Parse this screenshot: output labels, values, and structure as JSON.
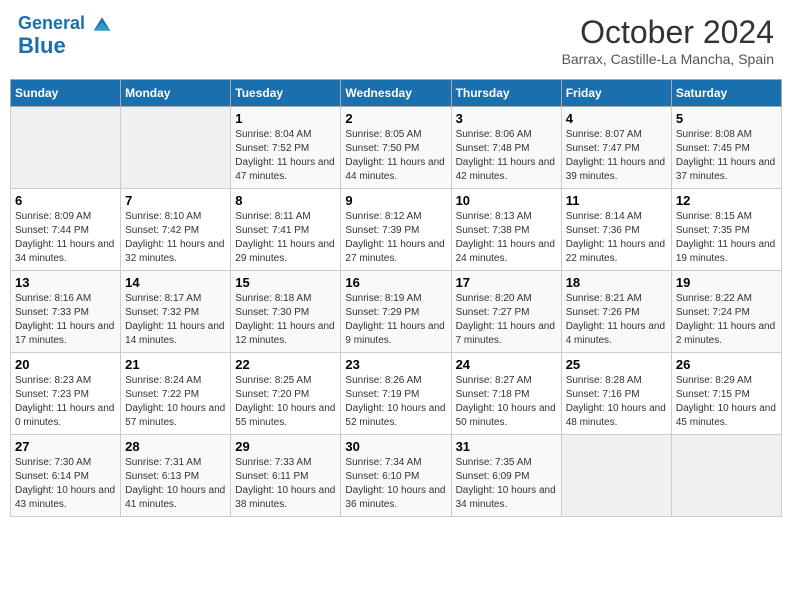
{
  "header": {
    "logo_line1": "General",
    "logo_line2": "Blue",
    "month": "October 2024",
    "location": "Barrax, Castille-La Mancha, Spain"
  },
  "weekdays": [
    "Sunday",
    "Monday",
    "Tuesday",
    "Wednesday",
    "Thursday",
    "Friday",
    "Saturday"
  ],
  "weeks": [
    [
      {
        "day": "",
        "info": ""
      },
      {
        "day": "",
        "info": ""
      },
      {
        "day": "1",
        "info": "Sunrise: 8:04 AM\nSunset: 7:52 PM\nDaylight: 11 hours and 47 minutes."
      },
      {
        "day": "2",
        "info": "Sunrise: 8:05 AM\nSunset: 7:50 PM\nDaylight: 11 hours and 44 minutes."
      },
      {
        "day": "3",
        "info": "Sunrise: 8:06 AM\nSunset: 7:48 PM\nDaylight: 11 hours and 42 minutes."
      },
      {
        "day": "4",
        "info": "Sunrise: 8:07 AM\nSunset: 7:47 PM\nDaylight: 11 hours and 39 minutes."
      },
      {
        "day": "5",
        "info": "Sunrise: 8:08 AM\nSunset: 7:45 PM\nDaylight: 11 hours and 37 minutes."
      }
    ],
    [
      {
        "day": "6",
        "info": "Sunrise: 8:09 AM\nSunset: 7:44 PM\nDaylight: 11 hours and 34 minutes."
      },
      {
        "day": "7",
        "info": "Sunrise: 8:10 AM\nSunset: 7:42 PM\nDaylight: 11 hours and 32 minutes."
      },
      {
        "day": "8",
        "info": "Sunrise: 8:11 AM\nSunset: 7:41 PM\nDaylight: 11 hours and 29 minutes."
      },
      {
        "day": "9",
        "info": "Sunrise: 8:12 AM\nSunset: 7:39 PM\nDaylight: 11 hours and 27 minutes."
      },
      {
        "day": "10",
        "info": "Sunrise: 8:13 AM\nSunset: 7:38 PM\nDaylight: 11 hours and 24 minutes."
      },
      {
        "day": "11",
        "info": "Sunrise: 8:14 AM\nSunset: 7:36 PM\nDaylight: 11 hours and 22 minutes."
      },
      {
        "day": "12",
        "info": "Sunrise: 8:15 AM\nSunset: 7:35 PM\nDaylight: 11 hours and 19 minutes."
      }
    ],
    [
      {
        "day": "13",
        "info": "Sunrise: 8:16 AM\nSunset: 7:33 PM\nDaylight: 11 hours and 17 minutes."
      },
      {
        "day": "14",
        "info": "Sunrise: 8:17 AM\nSunset: 7:32 PM\nDaylight: 11 hours and 14 minutes."
      },
      {
        "day": "15",
        "info": "Sunrise: 8:18 AM\nSunset: 7:30 PM\nDaylight: 11 hours and 12 minutes."
      },
      {
        "day": "16",
        "info": "Sunrise: 8:19 AM\nSunset: 7:29 PM\nDaylight: 11 hours and 9 minutes."
      },
      {
        "day": "17",
        "info": "Sunrise: 8:20 AM\nSunset: 7:27 PM\nDaylight: 11 hours and 7 minutes."
      },
      {
        "day": "18",
        "info": "Sunrise: 8:21 AM\nSunset: 7:26 PM\nDaylight: 11 hours and 4 minutes."
      },
      {
        "day": "19",
        "info": "Sunrise: 8:22 AM\nSunset: 7:24 PM\nDaylight: 11 hours and 2 minutes."
      }
    ],
    [
      {
        "day": "20",
        "info": "Sunrise: 8:23 AM\nSunset: 7:23 PM\nDaylight: 11 hours and 0 minutes."
      },
      {
        "day": "21",
        "info": "Sunrise: 8:24 AM\nSunset: 7:22 PM\nDaylight: 10 hours and 57 minutes."
      },
      {
        "day": "22",
        "info": "Sunrise: 8:25 AM\nSunset: 7:20 PM\nDaylight: 10 hours and 55 minutes."
      },
      {
        "day": "23",
        "info": "Sunrise: 8:26 AM\nSunset: 7:19 PM\nDaylight: 10 hours and 52 minutes."
      },
      {
        "day": "24",
        "info": "Sunrise: 8:27 AM\nSunset: 7:18 PM\nDaylight: 10 hours and 50 minutes."
      },
      {
        "day": "25",
        "info": "Sunrise: 8:28 AM\nSunset: 7:16 PM\nDaylight: 10 hours and 48 minutes."
      },
      {
        "day": "26",
        "info": "Sunrise: 8:29 AM\nSunset: 7:15 PM\nDaylight: 10 hours and 45 minutes."
      }
    ],
    [
      {
        "day": "27",
        "info": "Sunrise: 7:30 AM\nSunset: 6:14 PM\nDaylight: 10 hours and 43 minutes."
      },
      {
        "day": "28",
        "info": "Sunrise: 7:31 AM\nSunset: 6:13 PM\nDaylight: 10 hours and 41 minutes."
      },
      {
        "day": "29",
        "info": "Sunrise: 7:33 AM\nSunset: 6:11 PM\nDaylight: 10 hours and 38 minutes."
      },
      {
        "day": "30",
        "info": "Sunrise: 7:34 AM\nSunset: 6:10 PM\nDaylight: 10 hours and 36 minutes."
      },
      {
        "day": "31",
        "info": "Sunrise: 7:35 AM\nSunset: 6:09 PM\nDaylight: 10 hours and 34 minutes."
      },
      {
        "day": "",
        "info": ""
      },
      {
        "day": "",
        "info": ""
      }
    ]
  ]
}
